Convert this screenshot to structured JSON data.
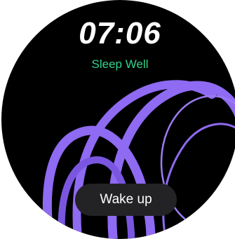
{
  "clock": {
    "time": "07:06"
  },
  "alarm": {
    "label": "Sleep Well",
    "label_color": "#2fd48a"
  },
  "actions": {
    "wake_up_label": "Wake up"
  },
  "theme": {
    "background": "#000000",
    "ring_color": "#8f6af2",
    "ring_color_dim": "#7a56e0"
  }
}
